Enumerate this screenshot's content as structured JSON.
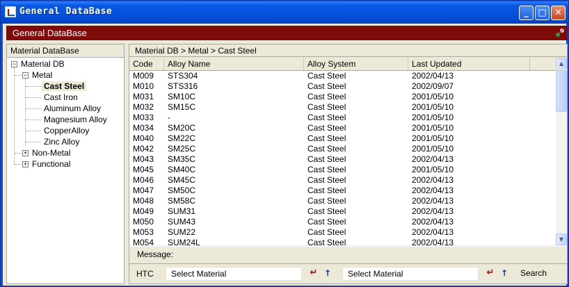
{
  "window": {
    "title": "General DataBase"
  },
  "appbar": {
    "title": "General DataBase"
  },
  "left_panel": {
    "header": "Material DataBase",
    "tree": {
      "root": "Material DB",
      "metal": "Metal",
      "metal_children": [
        "Cast Steel",
        "Cast Iron",
        "Aluminum Alloy",
        "Magnesium Alloy",
        "CopperAlloy",
        "Zinc Alloy"
      ],
      "selected": "Cast Steel",
      "non_metal": "Non-Metal",
      "functional": "Functional"
    }
  },
  "breadcrumb": "Material DB > Metal > Cast Steel",
  "grid": {
    "columns": [
      "Code",
      "Alloy Name",
      "Alloy System",
      "Last Updated"
    ],
    "rows": [
      [
        "M009",
        "STS304",
        "Cast Steel",
        "2002/04/13"
      ],
      [
        "M010",
        "STS316",
        "Cast Steel",
        "2002/09/07"
      ],
      [
        "M031",
        "SM10C",
        "Cast Steel",
        "2001/05/10"
      ],
      [
        "M032",
        "SM15C",
        "Cast Steel",
        "2001/05/10"
      ],
      [
        "M033",
        "-",
        "Cast Steel",
        "2001/05/10"
      ],
      [
        "M034",
        "SM20C",
        "Cast Steel",
        "2001/05/10"
      ],
      [
        "M040",
        "SM22C",
        "Cast Steel",
        "2001/05/10"
      ],
      [
        "M042",
        "SM25C",
        "Cast Steel",
        "2001/05/10"
      ],
      [
        "M043",
        "SM35C",
        "Cast Steel",
        "2002/04/13"
      ],
      [
        "M045",
        "SM40C",
        "Cast Steel",
        "2001/05/10"
      ],
      [
        "M046",
        "SM45C",
        "Cast Steel",
        "2002/04/13"
      ],
      [
        "M047",
        "SM50C",
        "Cast Steel",
        "2002/04/13"
      ],
      [
        "M048",
        "SM58C",
        "Cast Steel",
        "2002/04/13"
      ],
      [
        "M049",
        "SUM31",
        "Cast Steel",
        "2002/04/13"
      ],
      [
        "M050",
        "SUM43",
        "Cast Steel",
        "2002/04/13"
      ],
      [
        "M053",
        "SUM22",
        "Cast Steel",
        "2002/04/13"
      ],
      [
        "M054",
        "SUM24L",
        "Cast Steel",
        "2002/04/13"
      ]
    ]
  },
  "message_label": "Message:",
  "bottom": {
    "htc_label": "HTC",
    "select1": "Select Material",
    "select2": "Select Material",
    "search_label": "Search"
  },
  "colors": {
    "appbar": "#7f0a0a",
    "titlebar": "#0552dd"
  }
}
